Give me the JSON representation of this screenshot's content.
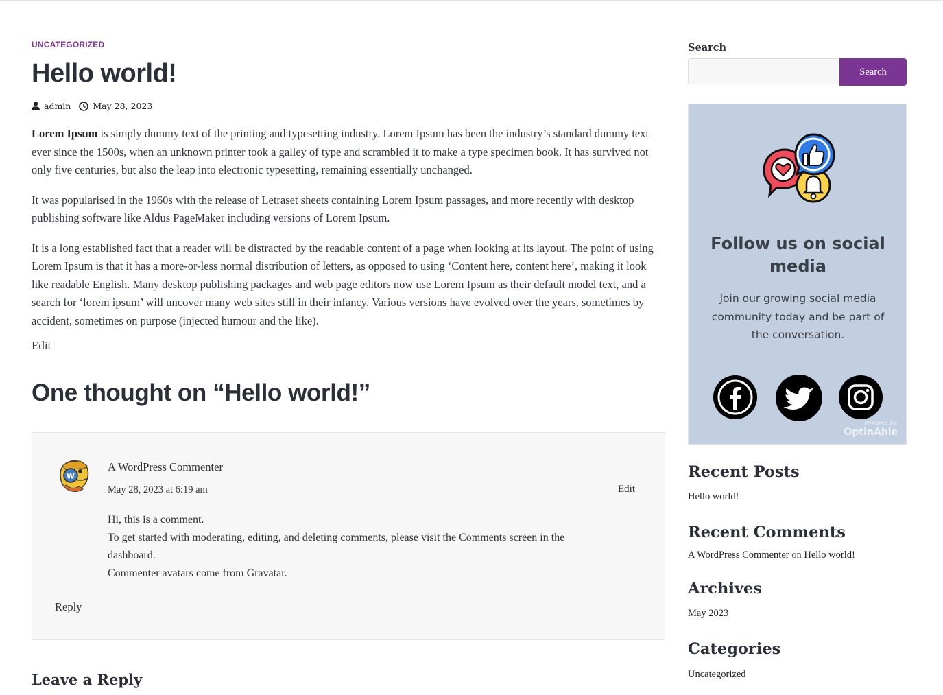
{
  "post": {
    "category": "Uncategorized",
    "title": "Hello world!",
    "author": "admin",
    "date": "May 28, 2023",
    "intro_bold": "Lorem Ipsum",
    "paragraph1_rest": " is simply dummy text of the printing and typesetting industry. Lorem Ipsum has been the industry’s standard dummy text ever since the 1500s, when an unknown printer took a galley of type and scrambled it to make a type specimen book. It has survived not only five centuries, but also the leap into electronic typesetting, remaining essentially unchanged.",
    "paragraph2": "It was popularised in the 1960s with the release of Letraset sheets containing Lorem Ipsum passages, and more recently with desktop publishing software like Aldus PageMaker including versions of Lorem Ipsum.",
    "paragraph3": "It is a long established fact that a reader will be distracted by the readable content of a page when looking at its layout. The point of using Lorem Ipsum is that it has a more-or-less normal distribution of letters, as opposed to using ‘Content here, content here’, making it look like readable English. Many desktop publishing packages and web page editors now use Lorem Ipsum as their default model text, and a search for ‘lorem ipsum’ will uncover many web sites still in their infancy. Various versions have evolved over the years, sometimes by accident, sometimes on purpose (injected humour and the like).",
    "edit_label": "Edit"
  },
  "comments": {
    "title": "One thought on “Hello world!”",
    "items": [
      {
        "author": "A WordPress Commenter",
        "date": "May 28, 2023 at 6:19 am",
        "edit_label": "Edit",
        "lines": [
          "Hi, this is a comment.",
          "To get started with moderating, editing, and deleting comments, please visit the Comments screen in the dashboard.",
          "Commenter avatars come from Gravatar."
        ],
        "reply_label": "Reply"
      }
    ],
    "leave_reply": "Leave a Reply"
  },
  "sidebar": {
    "search": {
      "label": "Search",
      "button_label": "Search",
      "value": ""
    },
    "social": {
      "title": "Follow us on social media",
      "text": "Join our growing social media community today and be part of the conversation.",
      "networks": [
        "facebook-icon",
        "twitter-icon",
        "instagram-icon"
      ],
      "powered_by": "Powered by:",
      "brand": "OptinAble",
      "background": "#c2cfe1"
    },
    "recent_posts": {
      "title": "Recent Posts",
      "items": [
        "Hello world!"
      ]
    },
    "recent_comments": {
      "title": "Recent Comments",
      "author": "A WordPress Commenter",
      "on": "on",
      "post": "Hello world!"
    },
    "archives": {
      "title": "Archives",
      "items": [
        "May 2023"
      ]
    },
    "categories": {
      "title": "Categories",
      "items": [
        "Uncategorized"
      ]
    }
  },
  "colors": {
    "accent": "#7b3593",
    "heading": "#2b2f38"
  }
}
